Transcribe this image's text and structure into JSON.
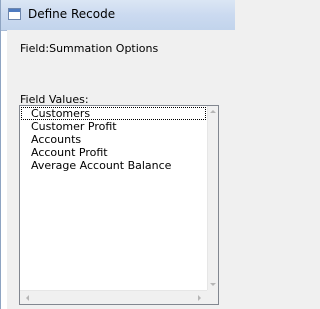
{
  "window": {
    "title": "Define Recode"
  },
  "field": {
    "text": "Field:Summation Options"
  },
  "field_values": {
    "label": "Field Values:",
    "items": [
      "Customers",
      "Customer Profit",
      "Accounts",
      "Account Profit",
      "Average Account Balance"
    ]
  },
  "icons": {
    "app": "window-icon",
    "scroll_up": "arrow-up-icon",
    "scroll_down": "arrow-down-icon",
    "scroll_left": "arrow-left-icon",
    "scroll_right": "arrow-right-icon"
  },
  "colors": {
    "titlebar": "#cbdaf0",
    "client_bg": "#f0f0f0",
    "listbox_border": "#828790",
    "scroll_arrow_disabled": "#b5b5b5"
  }
}
